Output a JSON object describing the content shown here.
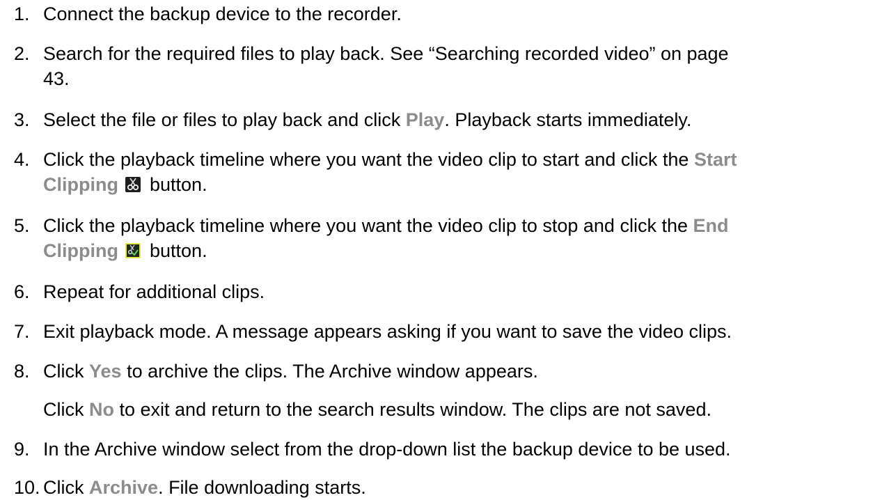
{
  "steps": [
    {
      "number": "1.",
      "text": "Connect the backup device to the recorder."
    },
    {
      "number": "2.",
      "line1": "Search for the required files to play back. See “Searching recorded video” on page",
      "line2": "43."
    },
    {
      "number": "3.",
      "pre": "Select the file or files to play back and click ",
      "kw": "Play",
      "post": ". Playback starts immediately."
    },
    {
      "number": "4.",
      "pre": "Click the playback timeline where you want the video clip to start and click the ",
      "kw1": "Start",
      "kw2": "Clipping",
      "post": " button.",
      "icon": "scissors-icon"
    },
    {
      "number": "5.",
      "pre": "Click the playback timeline where you want the video clip to stop and click the ",
      "kw1": "End",
      "kw2": "Clipping",
      "post": " button.",
      "icon": "scissors-check-icon"
    },
    {
      "number": "6.",
      "text": "Repeat for additional clips."
    },
    {
      "number": "7.",
      "text": "Exit playback mode. A message appears asking if you want to save the video clips."
    },
    {
      "number": "8.",
      "pre": "Click ",
      "kw": "Yes",
      "post": " to archive the clips. The Archive window appears.",
      "sub_pre": "Click ",
      "sub_kw": "No",
      "sub_post": " to exit and return to the search results window. The clips are not saved."
    },
    {
      "number": "9.",
      "text": "In the Archive window select from the drop-down list the backup device to be used."
    },
    {
      "number": "10.",
      "pre": "Click ",
      "kw": "Archive",
      "post": ". File downloading starts."
    }
  ],
  "colors": {
    "text": "#000000",
    "keyword": "#8c8c8c",
    "icon_border_highlight": "#e6e64a"
  }
}
